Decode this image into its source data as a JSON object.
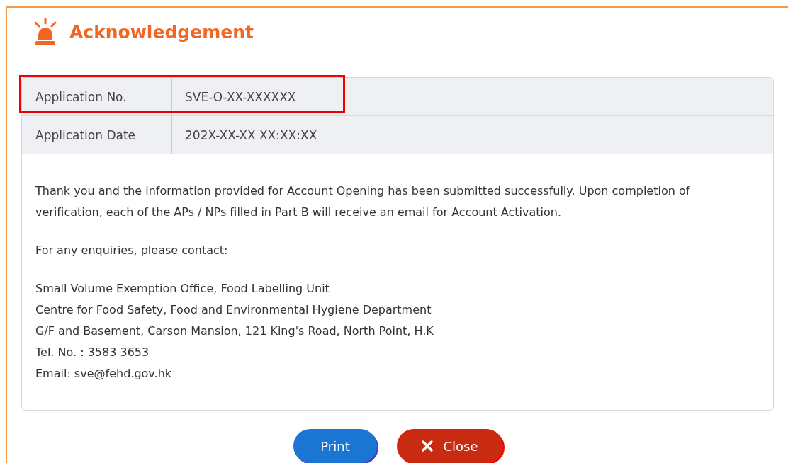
{
  "title": "Acknowledgement",
  "rows": [
    {
      "label": "Application No.",
      "value": "SVE-O-XX-XXXXXX",
      "highlighted": true
    },
    {
      "label": "Application Date",
      "value": "202X-XX-XX XX:XX:XX",
      "highlighted": false
    }
  ],
  "paragraphs": [
    "Thank you and the information provided for Account Opening has been submitted successfully. Upon completion of verification, each of the APs / NPs filled in Part B will receive an email for Account Activation.",
    "For any enquiries, please contact:"
  ],
  "contact_lines": [
    "Small Volume Exemption Office, Food Labelling Unit",
    "Centre for Food Safety, Food and Environmental Hygiene Department",
    "G/F and Basement, Carson Mansion, 121 King's Road, North Point, H.K",
    "Tel. No. : 3583 3653",
    "Email: sve@fehd.gov.hk"
  ],
  "buttons": [
    {
      "label": "Print",
      "kind": "print"
    },
    {
      "label": "Close",
      "kind": "close"
    }
  ]
}
